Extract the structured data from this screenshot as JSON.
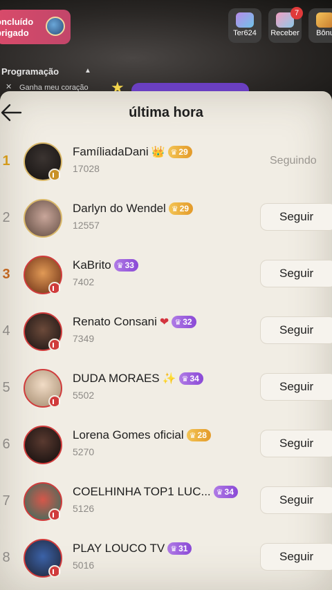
{
  "background": {
    "notice_line1": "oncluído",
    "notice_line2": "brigado",
    "buttons": [
      {
        "label": "Ter624",
        "icon": "gift-shell-icon"
      },
      {
        "label": "Receber",
        "icon": "reward-icon",
        "badge": "7"
      },
      {
        "label": "Bônu",
        "icon": "treasure-chest-icon"
      }
    ],
    "program_title": "Programação",
    "program_item": "Ganha meu coração"
  },
  "sheet": {
    "title": "última hora",
    "follow_label": "Seguir",
    "following_label": "Seguindo"
  },
  "ranking": [
    {
      "rank": "1",
      "name": "FamíliadaDani",
      "emoji": "👑",
      "level": "29",
      "level_color": "gold",
      "score": "17028",
      "status": "following"
    },
    {
      "rank": "2",
      "name": "Darlyn do Wendel",
      "emoji": "",
      "level": "29",
      "level_color": "gold",
      "score": "12557",
      "status": "follow"
    },
    {
      "rank": "3",
      "name": "KaBrito",
      "emoji": "",
      "level": "33",
      "level_color": "purple",
      "score": "7402",
      "status": "follow"
    },
    {
      "rank": "4",
      "name": "Renato Consani",
      "emoji": "❤",
      "level": "32",
      "level_color": "purple",
      "score": "7349",
      "status": "follow"
    },
    {
      "rank": "5",
      "name": "DUDA MORAES",
      "emoji": "✨",
      "level": "34",
      "level_color": "purple",
      "score": "5502",
      "status": "follow"
    },
    {
      "rank": "6",
      "name": "Lorena Gomes oficial",
      "emoji": "",
      "level": "28",
      "level_color": "gold",
      "score": "5270",
      "status": "follow"
    },
    {
      "rank": "7",
      "name": "COELHINHA TOP1 LUC...",
      "emoji": "",
      "level": "34",
      "level_color": "purple",
      "score": "5126",
      "status": "follow"
    },
    {
      "rank": "8",
      "name": "PLAY LOUCO TV",
      "emoji": "",
      "level": "31",
      "level_color": "purple",
      "score": "5016",
      "status": "follow"
    }
  ],
  "colors": {
    "sheet_bg": "#f1ede4",
    "rank_gold": "#d39a1c",
    "rank_bronze": "#c0651f",
    "level_gold": "#e39a2a",
    "level_purple": "#8a49d6",
    "live_red": "#d03c3c"
  }
}
